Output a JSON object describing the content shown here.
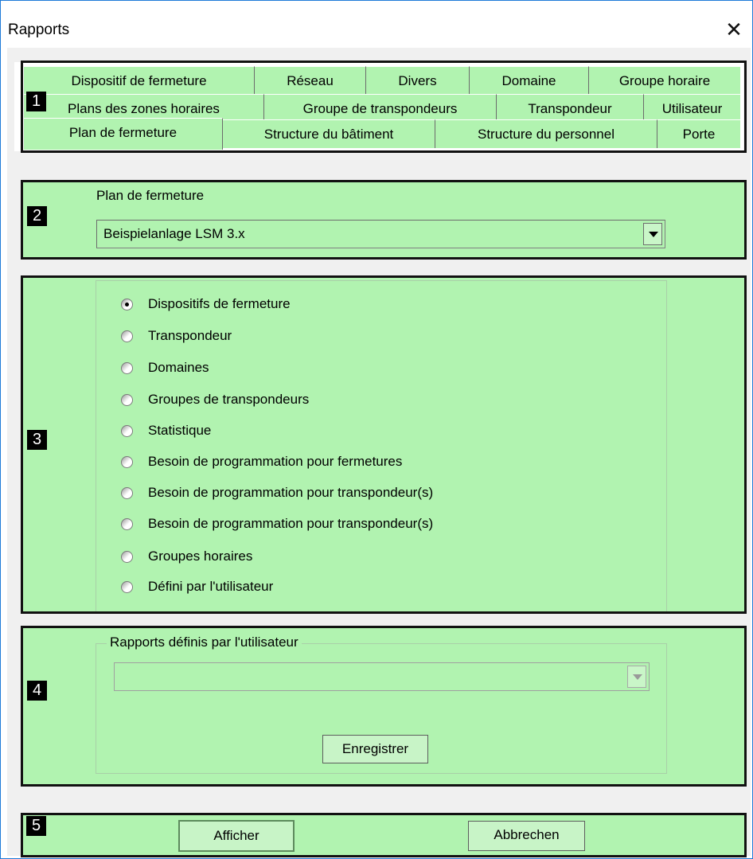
{
  "window": {
    "title": "Rapports"
  },
  "tabs": {
    "row_top": [
      "Dispositif de fermeture",
      "Réseau",
      "Divers",
      "Domaine",
      "Groupe horaire"
    ],
    "row_mid": [
      "Plans des zones horaires",
      "Groupe de transpondeurs",
      "Transpondeur",
      "Utilisateur"
    ],
    "row_bottom": [
      "Plan de fermeture",
      "Structure du bâtiment",
      "Structure du personnel",
      "Porte"
    ]
  },
  "callouts": [
    "1",
    "2",
    "3",
    "4",
    "5"
  ],
  "plan": {
    "label": "Plan de fermeture",
    "selected": "Beispielanlage LSM 3.x"
  },
  "reports": {
    "options": [
      "Dispositifs de fermeture",
      "Transpondeur",
      "Domaines",
      "Groupes de transpondeurs",
      "Statistique",
      "Besoin de programmation pour fermetures",
      "Besoin de programmation pour transpondeur(s)",
      "Besoin de programmation pour transpondeur(s)",
      "Groupes horaires",
      "Défini par l'utilisateur"
    ],
    "selected_index": 0
  },
  "user_reports": {
    "legend": "Rapports définis par l'utilisateur",
    "selected": "",
    "save_label": "Enregistrer"
  },
  "footer": {
    "show_label": "Afficher",
    "cancel_label": "Abbrechen"
  },
  "colors": {
    "panel": "#b1f3b0",
    "frame": "#1e7ad8",
    "callout": "#000000"
  }
}
